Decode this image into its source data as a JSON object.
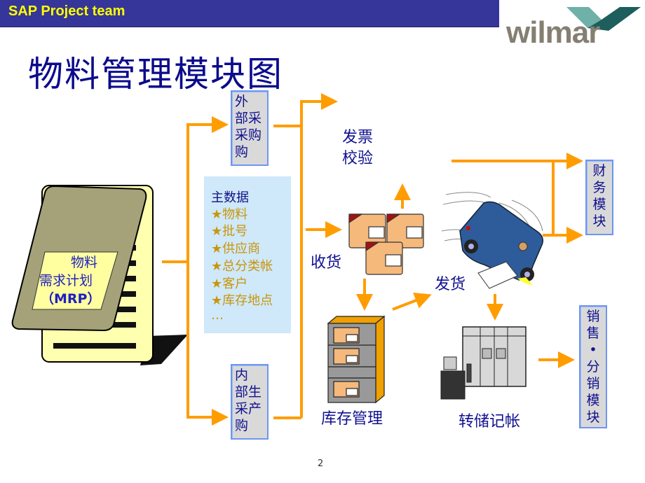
{
  "header": {
    "team_label": "SAP Project team",
    "logo_text": "wilmar"
  },
  "page_title": "物料管理模块图",
  "colors": {
    "header_bg": "#35359a",
    "header_text": "#ffff00",
    "title_text": "#0b0b8c",
    "arrow": "#ff9d00",
    "box_fill": "#d9d9d9",
    "box_border": "#6e96f0",
    "note_fill": "#cfe8fa",
    "note_item_text": "#c8960a"
  },
  "mrp": {
    "lines": [
      "物料",
      "需求计划",
      "（MRP）"
    ]
  },
  "boxes": {
    "external_purchase": [
      "外",
      "部采",
      "采购",
      "购"
    ],
    "internal_purchase": [
      "内",
      "部生",
      "采产",
      "购"
    ],
    "finance_module": [
      "财",
      "务",
      "模",
      "块"
    ],
    "sales_module": [
      "销",
      "售",
      "•",
      "分",
      "销",
      "模",
      "块"
    ]
  },
  "master_data": {
    "title": "主数据",
    "items": [
      "★物料",
      "★批号",
      "★供应商",
      "★总分类帐",
      "★客户",
      "★库存地点",
      "…"
    ]
  },
  "labels": {
    "invoice_verification": [
      "发票",
      "校验"
    ],
    "goods_receipt": "收货",
    "goods_issue": "发货",
    "inventory_management": "库存管理",
    "transfer_posting": "转储记帐"
  },
  "icons": {
    "mrp": "notepad-icon",
    "boxes": "cardboard-boxes-icon",
    "truck": "delivery-truck-icon",
    "shelf": "warehouse-shelf-icon",
    "computer": "mainframe-workstation-icon"
  },
  "page_number": "2"
}
